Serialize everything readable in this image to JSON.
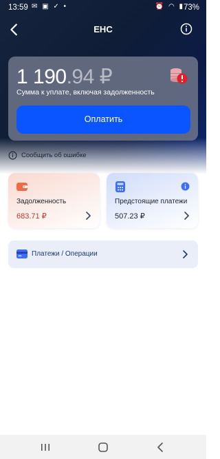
{
  "status_bar": {
    "time": "13:59",
    "battery": "73%"
  },
  "header": {
    "title": "ЕНС"
  },
  "balance_card": {
    "amount_main": "1 190",
    "amount_decimal": ".94 ₽",
    "caption": "Сумма к уплате, включая задолженность",
    "pay_label": "Оплатить"
  },
  "report_error": {
    "label": "Сообщить об ошибке"
  },
  "tiles": {
    "debt": {
      "label": "Задолженность",
      "value": "683.71 ₽",
      "color": "#c0392b"
    },
    "upcoming": {
      "label": "Предстоящие платежи",
      "value": "507.23 ₽",
      "color": "#1c2430"
    }
  },
  "operations": {
    "label": "Платежи / Операции"
  },
  "colors": {
    "accent": "#0a55ff",
    "danger": "#e0202a"
  },
  "icons": [
    "back-arrow-icon",
    "info-icon",
    "coins-alert-icon",
    "wallet-icon",
    "calculator-icon",
    "card-icon",
    "chevron-right-icon"
  ]
}
